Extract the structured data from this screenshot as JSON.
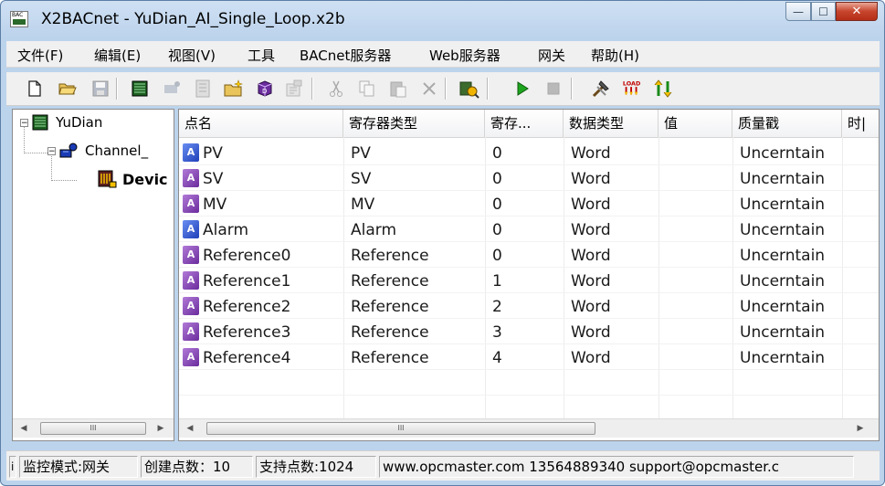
{
  "window": {
    "icon_text": "BAC",
    "title": "X2BACnet - YuDian_AI_Single_Loop.x2b",
    "min_glyph": "—",
    "max_glyph": "☐",
    "close_glyph": "✕"
  },
  "menu": {
    "items": [
      "文件(F)",
      "编辑(E)",
      "视图(V)",
      "工具",
      "BACnet服务器",
      "Web服务器",
      "网关",
      "帮助(H)"
    ]
  },
  "toolbar": {
    "icons": [
      "new-file-icon",
      "open-folder-icon",
      "save-icon",
      "add-channel-icon",
      "add-device-icon",
      "add-point-icon",
      "add-folder-icon",
      "add-3d-object-icon",
      "properties-icon",
      "cut-icon",
      "copy-icon",
      "paste-icon",
      "delete-icon",
      "tag-search-icon",
      "start-icon",
      "stop-icon",
      "tools-icon",
      "load-icon",
      "transfer-icon"
    ]
  },
  "tree": {
    "root": "YuDian",
    "channel": "Channel_",
    "device": "Devic",
    "expand_glyph": "−"
  },
  "table": {
    "columns": [
      "点名",
      "寄存器类型",
      "寄存...",
      "数据类型",
      "值",
      "质量戳",
      "时|"
    ],
    "rows": [
      {
        "name": "PV",
        "reg_type": "PV",
        "reg": "0",
        "dtype": "Word",
        "value": "",
        "quality": "Uncerntain",
        "icon": "blue"
      },
      {
        "name": "SV",
        "reg_type": "SV",
        "reg": "0",
        "dtype": "Word",
        "value": "",
        "quality": "Uncerntain",
        "icon": "purple"
      },
      {
        "name": "MV",
        "reg_type": "MV",
        "reg": "0",
        "dtype": "Word",
        "value": "",
        "quality": "Uncerntain",
        "icon": "purple"
      },
      {
        "name": "Alarm",
        "reg_type": "Alarm",
        "reg": "0",
        "dtype": "Word",
        "value": "",
        "quality": "Uncerntain",
        "icon": "blue"
      },
      {
        "name": "Reference0",
        "reg_type": "Reference",
        "reg": "0",
        "dtype": "Word",
        "value": "",
        "quality": "Uncerntain",
        "icon": "purple"
      },
      {
        "name": "Reference1",
        "reg_type": "Reference",
        "reg": "1",
        "dtype": "Word",
        "value": "",
        "quality": "Uncerntain",
        "icon": "purple"
      },
      {
        "name": "Reference2",
        "reg_type": "Reference",
        "reg": "2",
        "dtype": "Word",
        "value": "",
        "quality": "Uncerntain",
        "icon": "purple"
      },
      {
        "name": "Reference3",
        "reg_type": "Reference",
        "reg": "3",
        "dtype": "Word",
        "value": "",
        "quality": "Uncerntain",
        "icon": "purple"
      },
      {
        "name": "Reference4",
        "reg_type": "Reference",
        "reg": "4",
        "dtype": "Word",
        "value": "",
        "quality": "Uncerntain",
        "icon": "purple"
      }
    ],
    "point_icon_text": "A"
  },
  "scroll": {
    "left_arrow": "◀",
    "right_arrow": "▶",
    "thumb_grip": "III"
  },
  "status": {
    "marker": "i",
    "mode": "监控模式:网关",
    "created": "创建点数：10",
    "supported": "支持点数:1024",
    "contact": "www.opcmaster.com 13564889340 support@opcmaster.c"
  },
  "colors": {
    "point_blue": "#3a5bd9",
    "point_purple": "#8b45b8",
    "close_red": "#c7442c"
  }
}
